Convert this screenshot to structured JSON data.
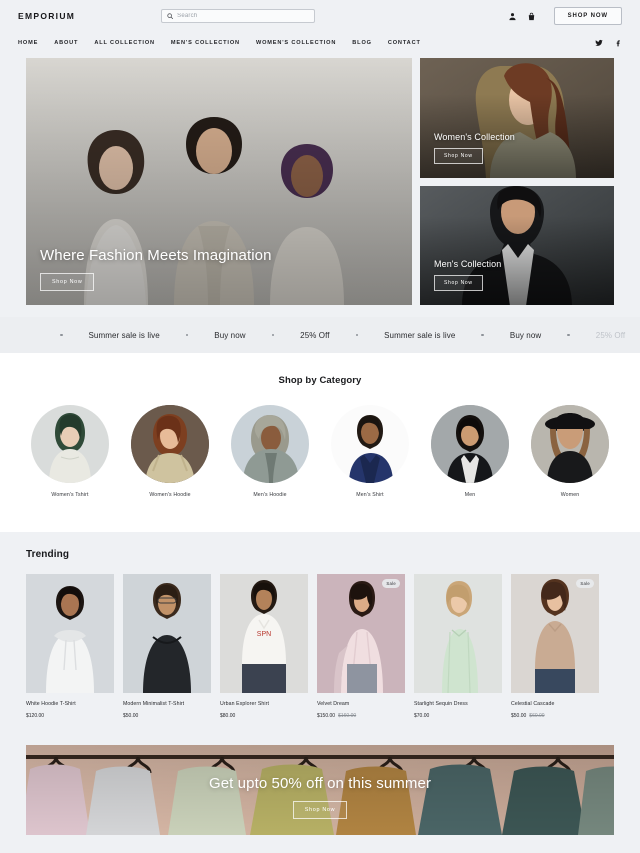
{
  "header": {
    "brand": "EMPORIUM",
    "search": {
      "placeholder": "Search",
      "value": "",
      "icon": "search-icon"
    },
    "account_icon": "user-icon",
    "cart_icon": "bag-icon",
    "shop_now_label": "SHOP NOW",
    "nav": [
      {
        "label": "HOME"
      },
      {
        "label": "ABOUT"
      },
      {
        "label": "ALL COLLECTION"
      },
      {
        "label": "MEN'S COLLECTION"
      },
      {
        "label": "WOMEN'S COLLECTION"
      },
      {
        "label": "BLOG"
      },
      {
        "label": "CONTACT"
      }
    ],
    "socials": [
      {
        "name": "twitter-icon"
      },
      {
        "name": "facebook-icon"
      }
    ]
  },
  "hero": {
    "main": {
      "title": "Where Fashion Meets Imagination",
      "cta": "Shop Now"
    },
    "cards": [
      {
        "title": "Women's Collection",
        "cta": "Shop Now"
      },
      {
        "title": "Men's Collection",
        "cta": "Shop Now"
      }
    ]
  },
  "marquee": {
    "items": [
      "Summer sale is live",
      "Buy now",
      "25% Off",
      "Summer sale is live",
      "Buy now",
      "25% Off"
    ]
  },
  "categories": {
    "title": "Shop by Category",
    "items": [
      {
        "label": "Women's Tshirt"
      },
      {
        "label": "Women's Hoodie"
      },
      {
        "label": "Men's Hoodie"
      },
      {
        "label": "Men's Shirt"
      },
      {
        "label": "Men"
      },
      {
        "label": "Women"
      }
    ]
  },
  "trending": {
    "title": "Trending",
    "products": [
      {
        "name": "White Hoodie T-Shirt",
        "price": "$120.00",
        "old_price": "",
        "badge": ""
      },
      {
        "name": "Modern Minimalist T-Shirt",
        "price": "$50.00",
        "old_price": "",
        "badge": ""
      },
      {
        "name": "Urban Explorer Shirt",
        "price": "$80.00",
        "old_price": "",
        "badge": ""
      },
      {
        "name": "Velvet Dream",
        "price": "$150.00",
        "old_price": "$160.00",
        "badge": "Sale"
      },
      {
        "name": "Starlight Sequin Dress",
        "price": "$70.00",
        "old_price": "",
        "badge": ""
      },
      {
        "name": "Celestial Cascade",
        "price": "$50.00",
        "old_price": "$60.00",
        "badge": "Sale"
      }
    ]
  },
  "promo": {
    "title": "Get upto 50% off on this summer",
    "cta": "Shop Now"
  },
  "colors": {
    "page_bg": "#eff1f4",
    "section_bg": "#ffffff",
    "text": "#1b1b1d",
    "muted": "#8b9096",
    "border": "#c6cad0"
  }
}
